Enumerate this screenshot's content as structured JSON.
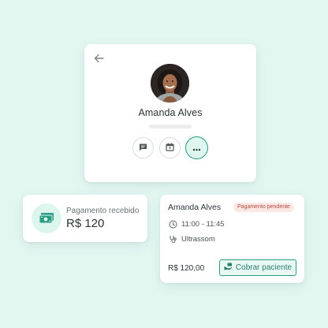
{
  "profile": {
    "name": "Amanda Alves",
    "actions": [
      {
        "icon": "message-icon"
      },
      {
        "icon": "calendar-icon"
      },
      {
        "icon": "more-icon"
      }
    ]
  },
  "payment": {
    "label": "Pagamento recebido",
    "amount": "R$ 120",
    "icon": "money-icon"
  },
  "appointment": {
    "patient": "Amanda Alves",
    "status": "Pagamento pendente",
    "time": "11:00 - 11:45",
    "service": "Ultrassom",
    "price": "R$ 120,00",
    "charge_label": "Cobrar paciente"
  },
  "colors": {
    "background": "#e3f7f1",
    "accent": "#2c9b84",
    "pending_badge_bg": "#fde8e6",
    "pending_badge_text": "#b34a3c"
  }
}
